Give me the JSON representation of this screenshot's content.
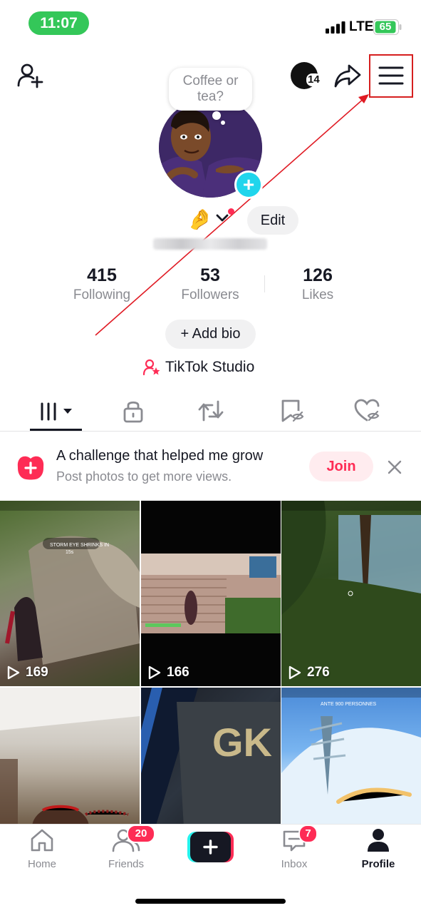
{
  "status_bar": {
    "time": "11:07",
    "network": "LTE",
    "battery": "65"
  },
  "header": {
    "notifications_count": "14"
  },
  "profile": {
    "note_text": "Coffee or tea?",
    "name_emoji": "🤌",
    "edit_label": "Edit"
  },
  "stats": {
    "following": {
      "value": "415",
      "label": "Following"
    },
    "followers": {
      "value": "53",
      "label": "Followers"
    },
    "likes": {
      "value": "126",
      "label": "Likes"
    }
  },
  "add_bio_label": "+ Add bio",
  "studio_label": "TikTok Studio",
  "tabs": [
    "videos-tab",
    "private-tab",
    "reposts-tab",
    "favorites-tab",
    "liked-tab"
  ],
  "banner": {
    "title": "A challenge that helped me grow",
    "subtitle": "Post photos to get more views.",
    "join_label": "Join"
  },
  "videos": [
    {
      "views": "169"
    },
    {
      "views": "166"
    },
    {
      "views": "276"
    },
    {
      "views": ""
    },
    {
      "views": ""
    },
    {
      "views": ""
    }
  ],
  "video_overlay_text": {
    "storm": "STORM EYE SHRINKS IN",
    "storm_time": "15s",
    "gk": "GK",
    "remaining": "ANTE 900 PERSONNES"
  },
  "bottom_nav": {
    "home": "Home",
    "friends": "Friends",
    "friends_badge": "20",
    "inbox": "Inbox",
    "inbox_badge": "7",
    "profile": "Profile"
  },
  "colors": {
    "accent": "#fe2c55",
    "highlight": "#d61f1f",
    "cyan": "#20d5ec",
    "status_green": "#34c759"
  }
}
